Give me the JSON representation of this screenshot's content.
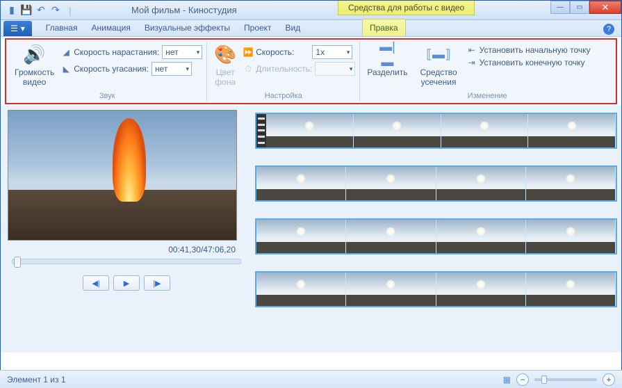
{
  "app": {
    "title": "Мой фильм - Киностудия",
    "contextual_tab": "Средства для работы с видео"
  },
  "ribbon_tabs": {
    "main": "Главная",
    "animation": "Анимация",
    "effects": "Визуальные эффекты",
    "project": "Проект",
    "view": "Вид",
    "edit": "Правка"
  },
  "ribbon": {
    "volume_label": "Громкость\nвидео",
    "fade_in_label": "Скорость нарастания:",
    "fade_in_value": "нет",
    "fade_out_label": "Скорость угасания:",
    "fade_out_value": "нет",
    "sound_group": "Звук",
    "bgcolor_label": "Цвет\nфона",
    "speed_label": "Скорость:",
    "speed_value": "1x",
    "duration_label": "Длительность:",
    "duration_value": "",
    "adjust_group": "Настройка",
    "split_label": "Разделить",
    "trim_label": "Средство\nусечения",
    "set_start_label": "Установить начальную точку",
    "set_end_label": "Установить конечную точку",
    "edit_group": "Изменение"
  },
  "preview": {
    "timecode": "00:41,30/47:06,20"
  },
  "status": {
    "text": "Элемент 1 из 1"
  }
}
